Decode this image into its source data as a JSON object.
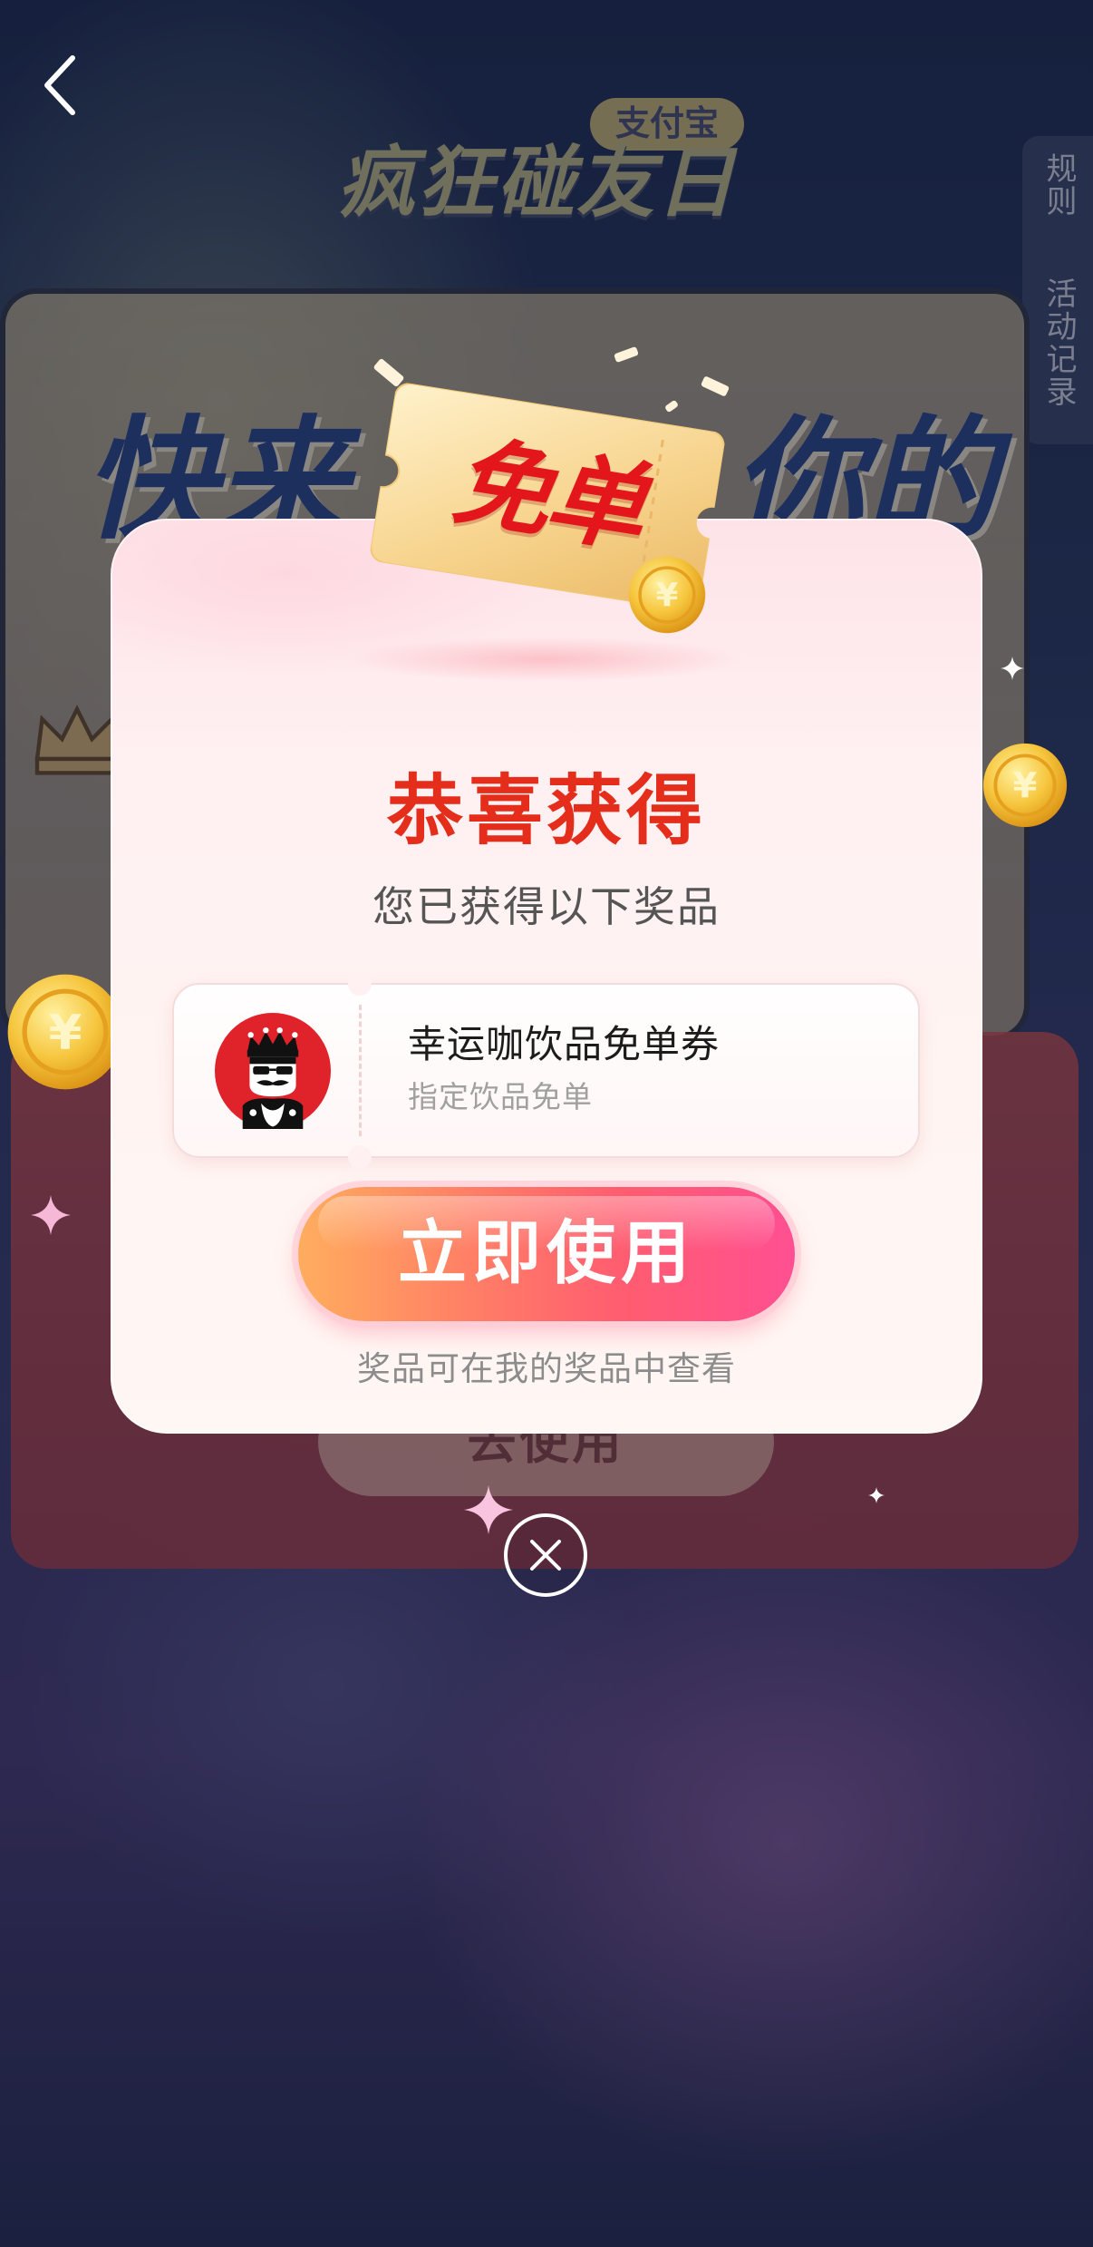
{
  "nav": {
    "back_icon": "chevron-left-icon"
  },
  "background": {
    "brand_badge": "支付宝",
    "event_title": "疯狂碰友日",
    "side_tabs": [
      {
        "label": "规则"
      },
      {
        "label": "活动记录"
      }
    ],
    "headline_left": "快来",
    "headline_right": "你的",
    "use_button_label": "去使用"
  },
  "modal": {
    "ticket_label": "免单",
    "title": "恭喜获得",
    "subtitle": "您已获得以下奖品",
    "prize": {
      "logo_icon": "king-card-logo-icon",
      "name": "幸运咖饮品免单券",
      "desc": "指定饮品免单"
    },
    "primary_button": "立即使用",
    "footer_note": "奖品可在我的奖品中查看",
    "close_icon": "close-circle-icon"
  },
  "decor": {
    "coin_icon": "yuan-coin-icon",
    "coin_symbol": "¥",
    "sparkle_icon": "sparkle-icon"
  },
  "colors": {
    "title_red": "#e42d1b",
    "ticket_red": "#e3161c",
    "button_gradient_start": "#ffad5e",
    "button_gradient_end": "#ff4f92",
    "modal_bg": "#fff4f2",
    "mask": "rgba(12,14,34,0.45)"
  }
}
